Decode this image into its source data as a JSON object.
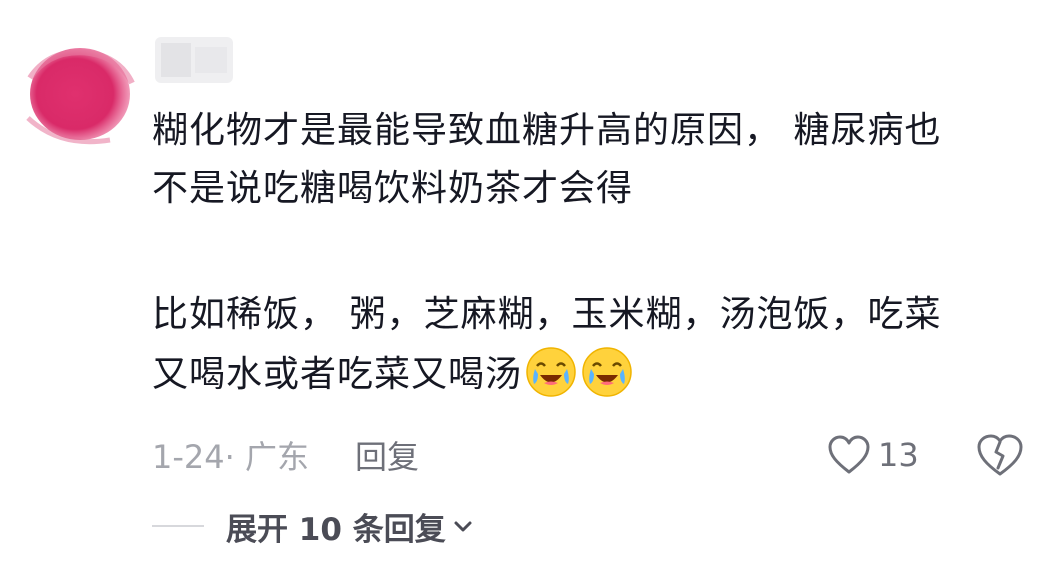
{
  "comment": {
    "body_line_1": "糊化物才是最能导致血糖升高的原因， 糖尿病也",
    "body_line_2": "不是说吃糖喝饮料奶茶才会得",
    "body_line_3": "比如稀饭， 粥，芝麻糊，玉米糊，汤泡饭，吃菜",
    "body_line_4": "又喝水或者吃菜又喝汤",
    "emojis": [
      "laugh-cry-emoji",
      "laugh-cry-emoji"
    ],
    "date_location": "1-24· 广东",
    "reply_label": "回复",
    "like_count": "13",
    "expand_label": "展开 10 条回复"
  },
  "icons": {
    "like": "heart-outline-icon",
    "dislike": "broken-heart-icon",
    "expand": "chevron-down-icon"
  },
  "colors": {
    "avatar": "#e0306e",
    "text_primary": "#161823",
    "text_secondary": "#a4a6ad",
    "action": "#6e7079"
  }
}
